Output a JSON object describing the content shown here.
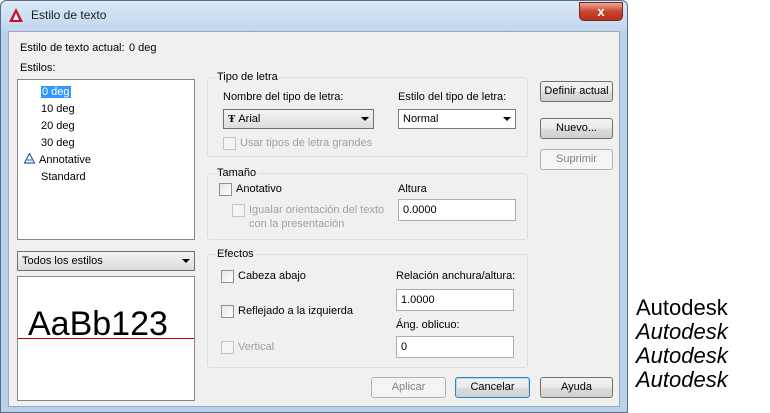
{
  "window": {
    "title": "Estilo de texto",
    "close_label": "x"
  },
  "current_style": {
    "label": "Estilo de texto actual:",
    "value": "0 deg"
  },
  "styles": {
    "label": "Estilos:",
    "items": [
      {
        "label": "0 deg",
        "selected": true,
        "annotative": false
      },
      {
        "label": "10 deg",
        "selected": false,
        "annotative": false
      },
      {
        "label": "20 deg",
        "selected": false,
        "annotative": false
      },
      {
        "label": "30 deg",
        "selected": false,
        "annotative": false
      },
      {
        "label": "Annotative",
        "selected": false,
        "annotative": true
      },
      {
        "label": "Standard",
        "selected": false,
        "annotative": false
      }
    ],
    "filter_value": "Todos los estilos"
  },
  "preview": {
    "sample_text": "AaBb123"
  },
  "font_group": {
    "title": "Tipo de letra",
    "font_name_label": "Nombre del tipo de letra:",
    "font_name_value": "Arial",
    "font_style_label": "Estilo del tipo de letra:",
    "font_style_value": "Normal",
    "big_font_label": "Usar tipos de letra grandes",
    "big_font_checked": false
  },
  "size_group": {
    "title": "Tamaño",
    "annotative_label": "Anotativo",
    "annotative_checked": false,
    "match_orientation_label_line1": "Igualar orientación del texto",
    "match_orientation_label_line2": "con la presentación",
    "height_label": "Altura",
    "height_value": "0.0000"
  },
  "effects_group": {
    "title": "Efectos",
    "upside_down_label": "Cabeza abajo",
    "backwards_label": "Reflejado a la izquierda",
    "vertical_label": "Vertical",
    "width_factor_label": "Relación anchura/altura:",
    "width_factor_value": "1.0000",
    "oblique_label": "Áng. oblicuo:",
    "oblique_value": "0"
  },
  "buttons": {
    "set_current": "Definir actual",
    "new": "Nuevo...",
    "delete": "Suprimir",
    "apply": "Aplicar",
    "cancel": "Cancelar",
    "help": "Ayuda"
  },
  "side_samples": [
    "Autodesk",
    "Autodesk",
    "Autodesk",
    "Autodesk"
  ],
  "colors": {
    "selection": "#3399ff",
    "baseline": "#cc0000",
    "close_button": "#c9452f"
  }
}
